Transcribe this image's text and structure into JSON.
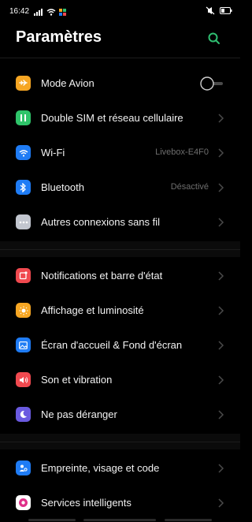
{
  "status": {
    "time": "16:42"
  },
  "header": {
    "title": "Paramètres"
  },
  "sections": [
    [
      {
        "name": "mode-avion",
        "label": "Mode Avion",
        "icon": "airplane-icon",
        "color": "#f6a623",
        "kind": "toggle"
      },
      {
        "name": "double-sim",
        "label": "Double SIM et réseau cellulaire",
        "icon": "sim-icon",
        "color": "#2fc46a",
        "kind": "chev"
      },
      {
        "name": "wifi",
        "label": "Wi-Fi",
        "value": "Livebox-E4F0",
        "icon": "wifi-icon",
        "color": "#1f7cf5",
        "kind": "chev"
      },
      {
        "name": "bluetooth",
        "label": "Bluetooth",
        "value": "Désactivé",
        "icon": "bluetooth-icon",
        "color": "#1f7cf5",
        "kind": "chev"
      },
      {
        "name": "autres-connexions",
        "label": "Autres connexions sans fil",
        "icon": "more-icon",
        "color": "#c2c6cf",
        "kind": "chev"
      }
    ],
    [
      {
        "name": "notifications",
        "label": "Notifications et barre d'état",
        "icon": "notification-icon",
        "color": "#f0494f",
        "kind": "chev"
      },
      {
        "name": "affichage",
        "label": "Affichage et luminosité",
        "icon": "brightness-icon",
        "color": "#f6a623",
        "kind": "chev"
      },
      {
        "name": "ecran-accueil",
        "label": "Écran d'accueil & Fond d'écran",
        "icon": "wallpaper-icon",
        "color": "#1f7cf5",
        "kind": "chev"
      },
      {
        "name": "son",
        "label": "Son et vibration",
        "icon": "sound-icon",
        "color": "#f0494f",
        "kind": "chev"
      },
      {
        "name": "ne-pas-deranger",
        "label": "Ne pas déranger",
        "icon": "moon-icon",
        "color": "#6a5ae0",
        "kind": "chev"
      }
    ],
    [
      {
        "name": "empreinte",
        "label": "Empreinte, visage et code",
        "icon": "fingerprint-icon",
        "color": "#1f7cf5",
        "kind": "chev"
      },
      {
        "name": "services",
        "label": "Services intelligents",
        "icon": "smart-icon",
        "color": "#e0308a",
        "kind": "chev"
      }
    ]
  ],
  "colors": {
    "accent": "#2fbf71",
    "background": "#000000",
    "secondary_text": "#6e6e6e"
  }
}
